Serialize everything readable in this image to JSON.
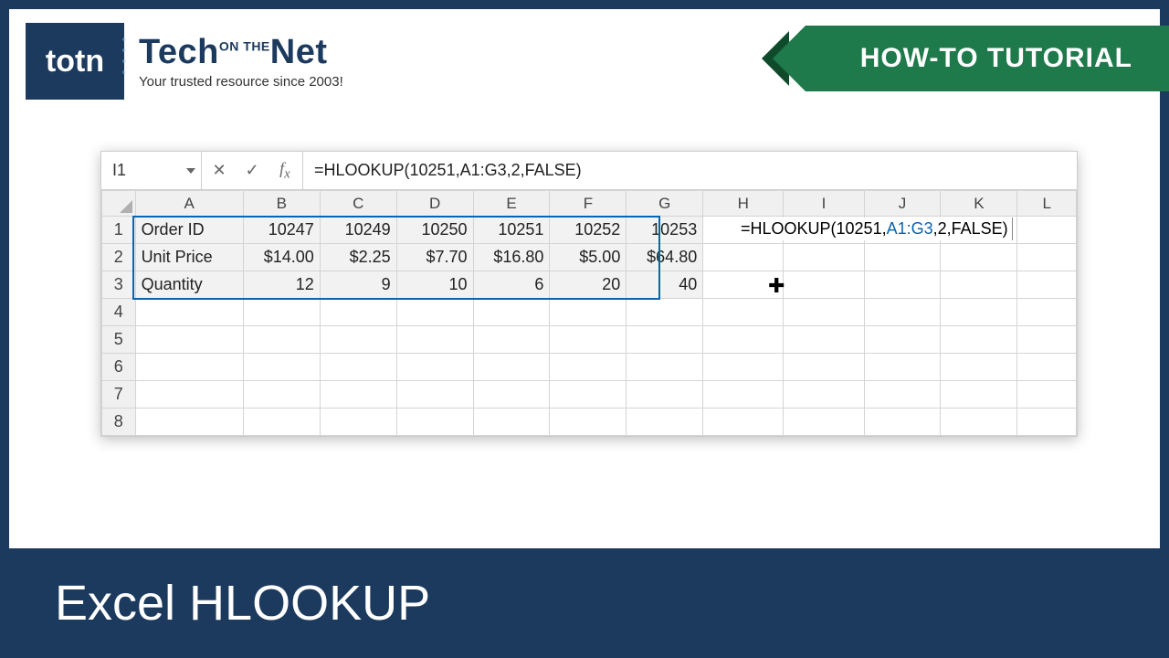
{
  "header": {
    "logo_abbr": "totn",
    "logo_main_pre": "Tech",
    "logo_main_small": "ON THE",
    "logo_main_post": "Net",
    "tagline": "Your trusted resource since 2003!"
  },
  "ribbon": {
    "text": "HOW-TO TUTORIAL"
  },
  "formula_bar": {
    "cell_ref": "I1",
    "formula": "=HLOOKUP(10251,A1:G3,2,FALSE)"
  },
  "columns": [
    "A",
    "B",
    "C",
    "D",
    "E",
    "F",
    "G",
    "H",
    "I",
    "J",
    "K",
    "L"
  ],
  "active_column": "I",
  "active_row": 1,
  "selected_range": "A1:G3",
  "rows_shown": 8,
  "grid": {
    "r1": [
      "Order ID",
      "10247",
      "10249",
      "10250",
      "10251",
      "10252",
      "10253",
      "",
      "",
      "",
      "",
      ""
    ],
    "r2": [
      "Unit Price",
      "$14.00",
      "$2.25",
      "$7.70",
      "$16.80",
      "$5.00",
      "$64.80",
      "",
      "",
      "",
      "",
      ""
    ],
    "r3": [
      "Quantity",
      "12",
      "9",
      "10",
      "6",
      "20",
      "40",
      "",
      "",
      "",
      "",
      ""
    ]
  },
  "cell_edit": {
    "prefix": "=HLOOKUP(10251,",
    "range_ref": "A1:G3",
    "suffix": ",2,FALSE)"
  },
  "footer": {
    "title": "Excel HLOOKUP"
  }
}
